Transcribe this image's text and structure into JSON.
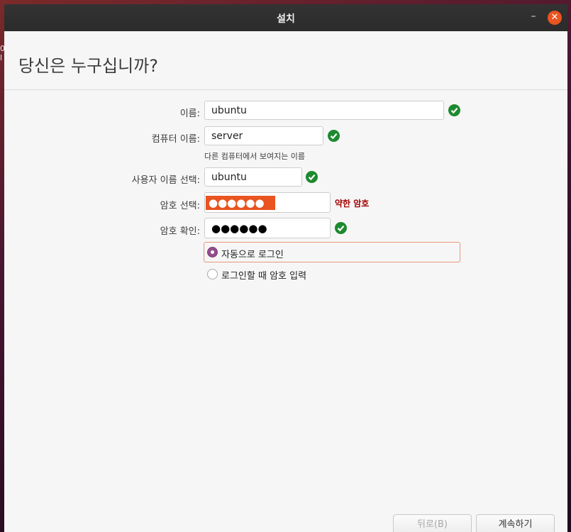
{
  "desktop": {
    "edge_text": "0\nl"
  },
  "window": {
    "title": "설치"
  },
  "page": {
    "title": "당신은 누구십니까?"
  },
  "form": {
    "name": {
      "label": "이름:",
      "value": "ubuntu"
    },
    "computer": {
      "label": "컴퓨터 이름:",
      "value": "server",
      "hint": "다른 컴퓨터에서 보여지는 이름"
    },
    "username": {
      "label": "사용자 이름 선택:",
      "value": "ubuntu"
    },
    "password": {
      "label": "암호 선택:",
      "value_masked": "●●●●●●",
      "strength": "약한 암호"
    },
    "confirm": {
      "label": "암호 확인:",
      "value_masked": "●●●●●●"
    }
  },
  "login_options": [
    {
      "label": "자동으로 로그인",
      "selected": true
    },
    {
      "label": "로그인할 때 암호 입력",
      "selected": false
    }
  ],
  "buttons": {
    "back": "뒤로(B)",
    "next": "계속하기"
  },
  "colors": {
    "accent": "#e95420",
    "check": "#1d8a2f",
    "weak": "#a30000",
    "radio": "#924d8b"
  },
  "icons": {
    "minimize": "minimize-icon",
    "close": "close-icon",
    "valid": "check-circle-icon"
  }
}
